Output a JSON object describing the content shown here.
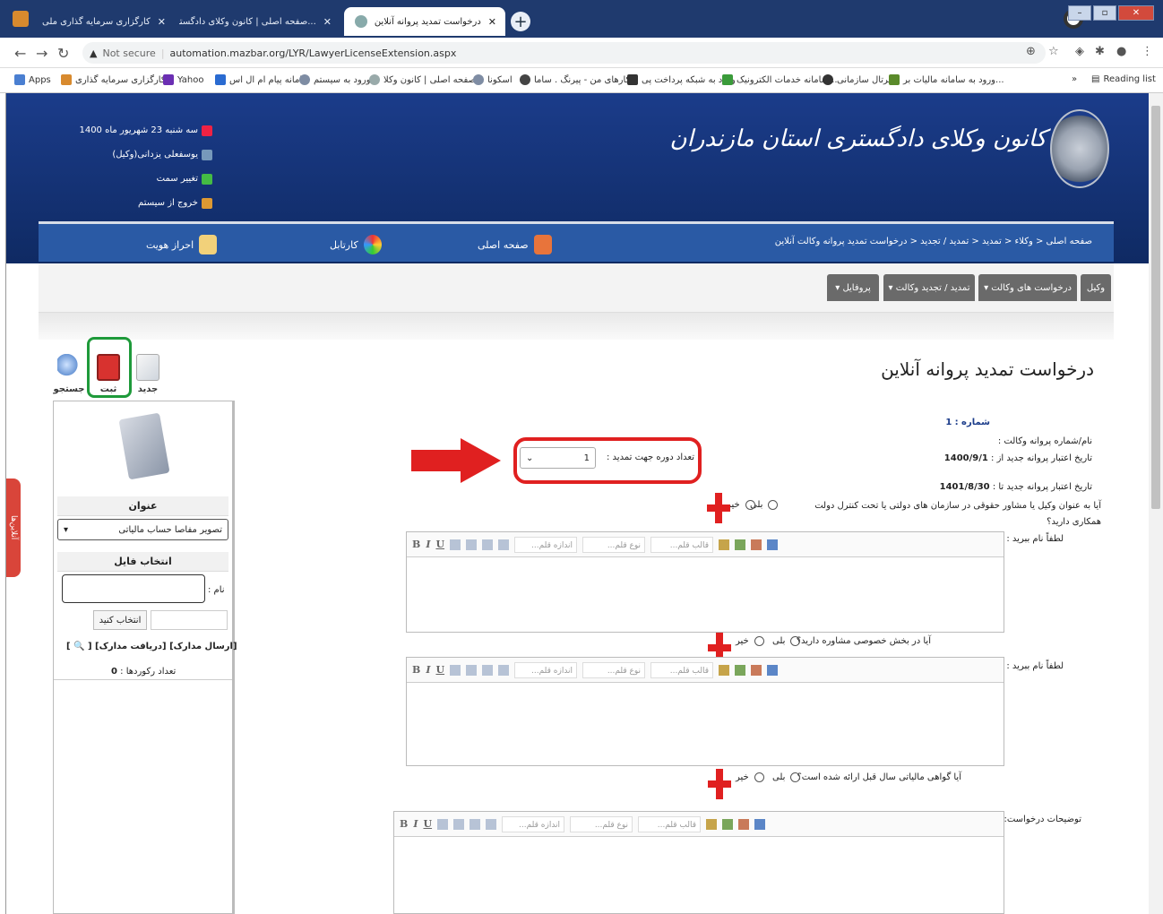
{
  "browser": {
    "tabs": [
      {
        "label": "کارگزاری سرمایه گذاری ملی",
        "active": false
      },
      {
        "label": "صفحه اصلی | کانون وکلای دادگستری استا...",
        "active": false
      },
      {
        "label": "درخواست تمدید پروانه آنلاین",
        "active": true
      }
    ],
    "url": "automation.mazbar.org/LYR/LawyerLicenseExtension.aspx",
    "not_secure": "Not secure",
    "new_tab": "+",
    "bookmarks": [
      "Apps",
      "کارگزاری سرمایه گذاری...",
      "Yahoo",
      "سامانه پیام ام ال اس",
      "ورود به سیستم",
      "صفحه اصلی | کانون وکلا...",
      "اسکونا",
      "کارهای من - پیرنگ . ساما...",
      "ورود به شبکه پرداخت پی",
      "سامانه خدمات الکترونیک...",
      "پرتال سازمانی",
      "ورود به سامانه مالیات بر..."
    ],
    "more_bookmarks": "»",
    "reading_list": "Reading list"
  },
  "header": {
    "org_title": "کانون وکلای دادگستری استان مازندران",
    "date": "سه شنبه 23 شهریور ماه 1400",
    "user": "یوسفعلی یزدانی(وکیل)",
    "change_role": "تغییر سمت",
    "logout": "خروج از سیستم"
  },
  "nav": {
    "auth": "احراز هویت",
    "cartable": "کارتابل",
    "home": "صفحه اصلی",
    "breadcrumb": "صفحه اصلی < وکلاء < تمدید < تمدید / تجدید < درخواست تمدید پروانه وکالت آنلاین"
  },
  "menu": [
    "وکیل",
    "درخواست های وکالت ▾",
    "تمدید / تجدید وکالت ▾",
    "پروفایل ▾"
  ],
  "toolbar": {
    "new": "جدید",
    "save": "ثبت",
    "search": "جستجو"
  },
  "sidebar": {
    "title_header": "عنوان",
    "doc_type": "تصویر مفاصا حساب مالیاتی",
    "choose_file_header": "انتخاب فایل",
    "name_label": "نام :",
    "browse": "انتخاب کنید",
    "links": "[ارسال مدارک] [دریافت مدارک] [",
    "link_end": "]",
    "records_label": "تعداد رکوردها :",
    "records_count": "0",
    "side_tab": "آنلاین‌ها"
  },
  "form": {
    "title": "درخواست تمدید پروانه آنلاین",
    "number_label": "شماره :",
    "number_value": "1",
    "license_label": "نام/شماره پروانه وکالت :",
    "valid_from_label": "تاریخ اعتبار پروانه جدید از :",
    "valid_from": "1400/9/1",
    "valid_to_label": "تاریخ اعتبار پروانه جدید تا :",
    "valid_to": "1401/8/30",
    "period_label": "تعداد دوره جهت تمدید :",
    "period_value": "1",
    "q1": "آیا به عنوان وکیل یا مشاور حقوقی در سازمان های دولتی یا تحت کنترل دولت همکاری دارید؟",
    "q2": "آیا در بخش خصوصی مشاوره دارید؟",
    "q3": "آیا گواهی مالیاتی سال قبل ارائه شده است؟",
    "yes": "بلی",
    "no": "خیر",
    "name_prompt": "لطفاً نام ببرید :",
    "description_label": "توضیحات درخواست:"
  },
  "editor": {
    "size": "اندازه قلم...",
    "font": "نوع قلم...",
    "format": "قالب قلم..."
  },
  "colors": {
    "banner": "#1b3c8a",
    "nav": "#2a5aa5",
    "highlight_red": "#e02020",
    "highlight_green": "#1e9a3a"
  }
}
